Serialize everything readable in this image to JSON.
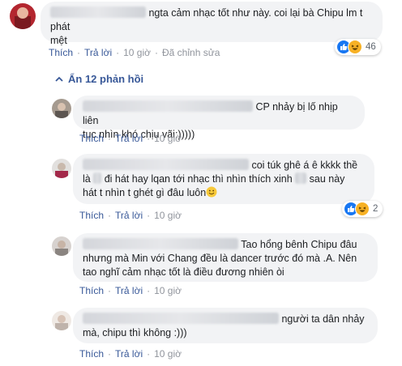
{
  "comments": [
    {
      "text_pre": "ngta cảm nhạc tốt như này. coi lại bà Chipu lm t phát",
      "text_line2": "mệt",
      "actions": {
        "like": "Thích",
        "reply": "Trả lời",
        "time": "10 giờ",
        "edited": "Đã chỉnh sửa"
      },
      "reaction_count": "46"
    }
  ],
  "replies_toggle": "Ẩn 12 phản hồi",
  "replies": [
    {
      "line1": "CP nhảy bị lố nhịp liên",
      "line2": "tục nhìn khó chịu vãi:)))))",
      "actions": {
        "like": "Thích",
        "reply": "Trả lời",
        "time": "10 giờ"
      }
    },
    {
      "line1": "coi túk ghê á ê kkkk thề",
      "line2_a": "là",
      "line2_b": "đi hát hay lqan tới nhạc thì nhìn thích xinh",
      "line2_c": "sau này",
      "line3": "hát t nhìn t ghét gì đâu luôn",
      "actions": {
        "like": "Thích",
        "reply": "Trả lời",
        "time": "10 giờ"
      },
      "reaction_count": "2"
    },
    {
      "line1": "Tao hổng bênh Chipu đâu",
      "line2": "nhưng mà Min với Chang đều là dancer trước đó mà .A. Nên",
      "line3": "tao nghĩ cảm nhạc tốt là điều đương nhiên òi",
      "actions": {
        "like": "Thích",
        "reply": "Trả lời",
        "time": "10 giờ"
      }
    },
    {
      "line1": "người ta dân nhảy",
      "line2": "mà, chipu thì không :)))",
      "actions": {
        "like": "Thích",
        "reply": "Trả lời",
        "time": "10 giờ"
      }
    }
  ],
  "icons": {
    "like": "like-icon",
    "haha": "haha-icon",
    "chevron": "chevron-up-icon",
    "smile": "smile-emoji-icon"
  },
  "colors": {
    "link": "#385898",
    "like_blue": "#1877f2",
    "haha_yellow": "#f7b125",
    "bubble": "#f2f3f5"
  }
}
